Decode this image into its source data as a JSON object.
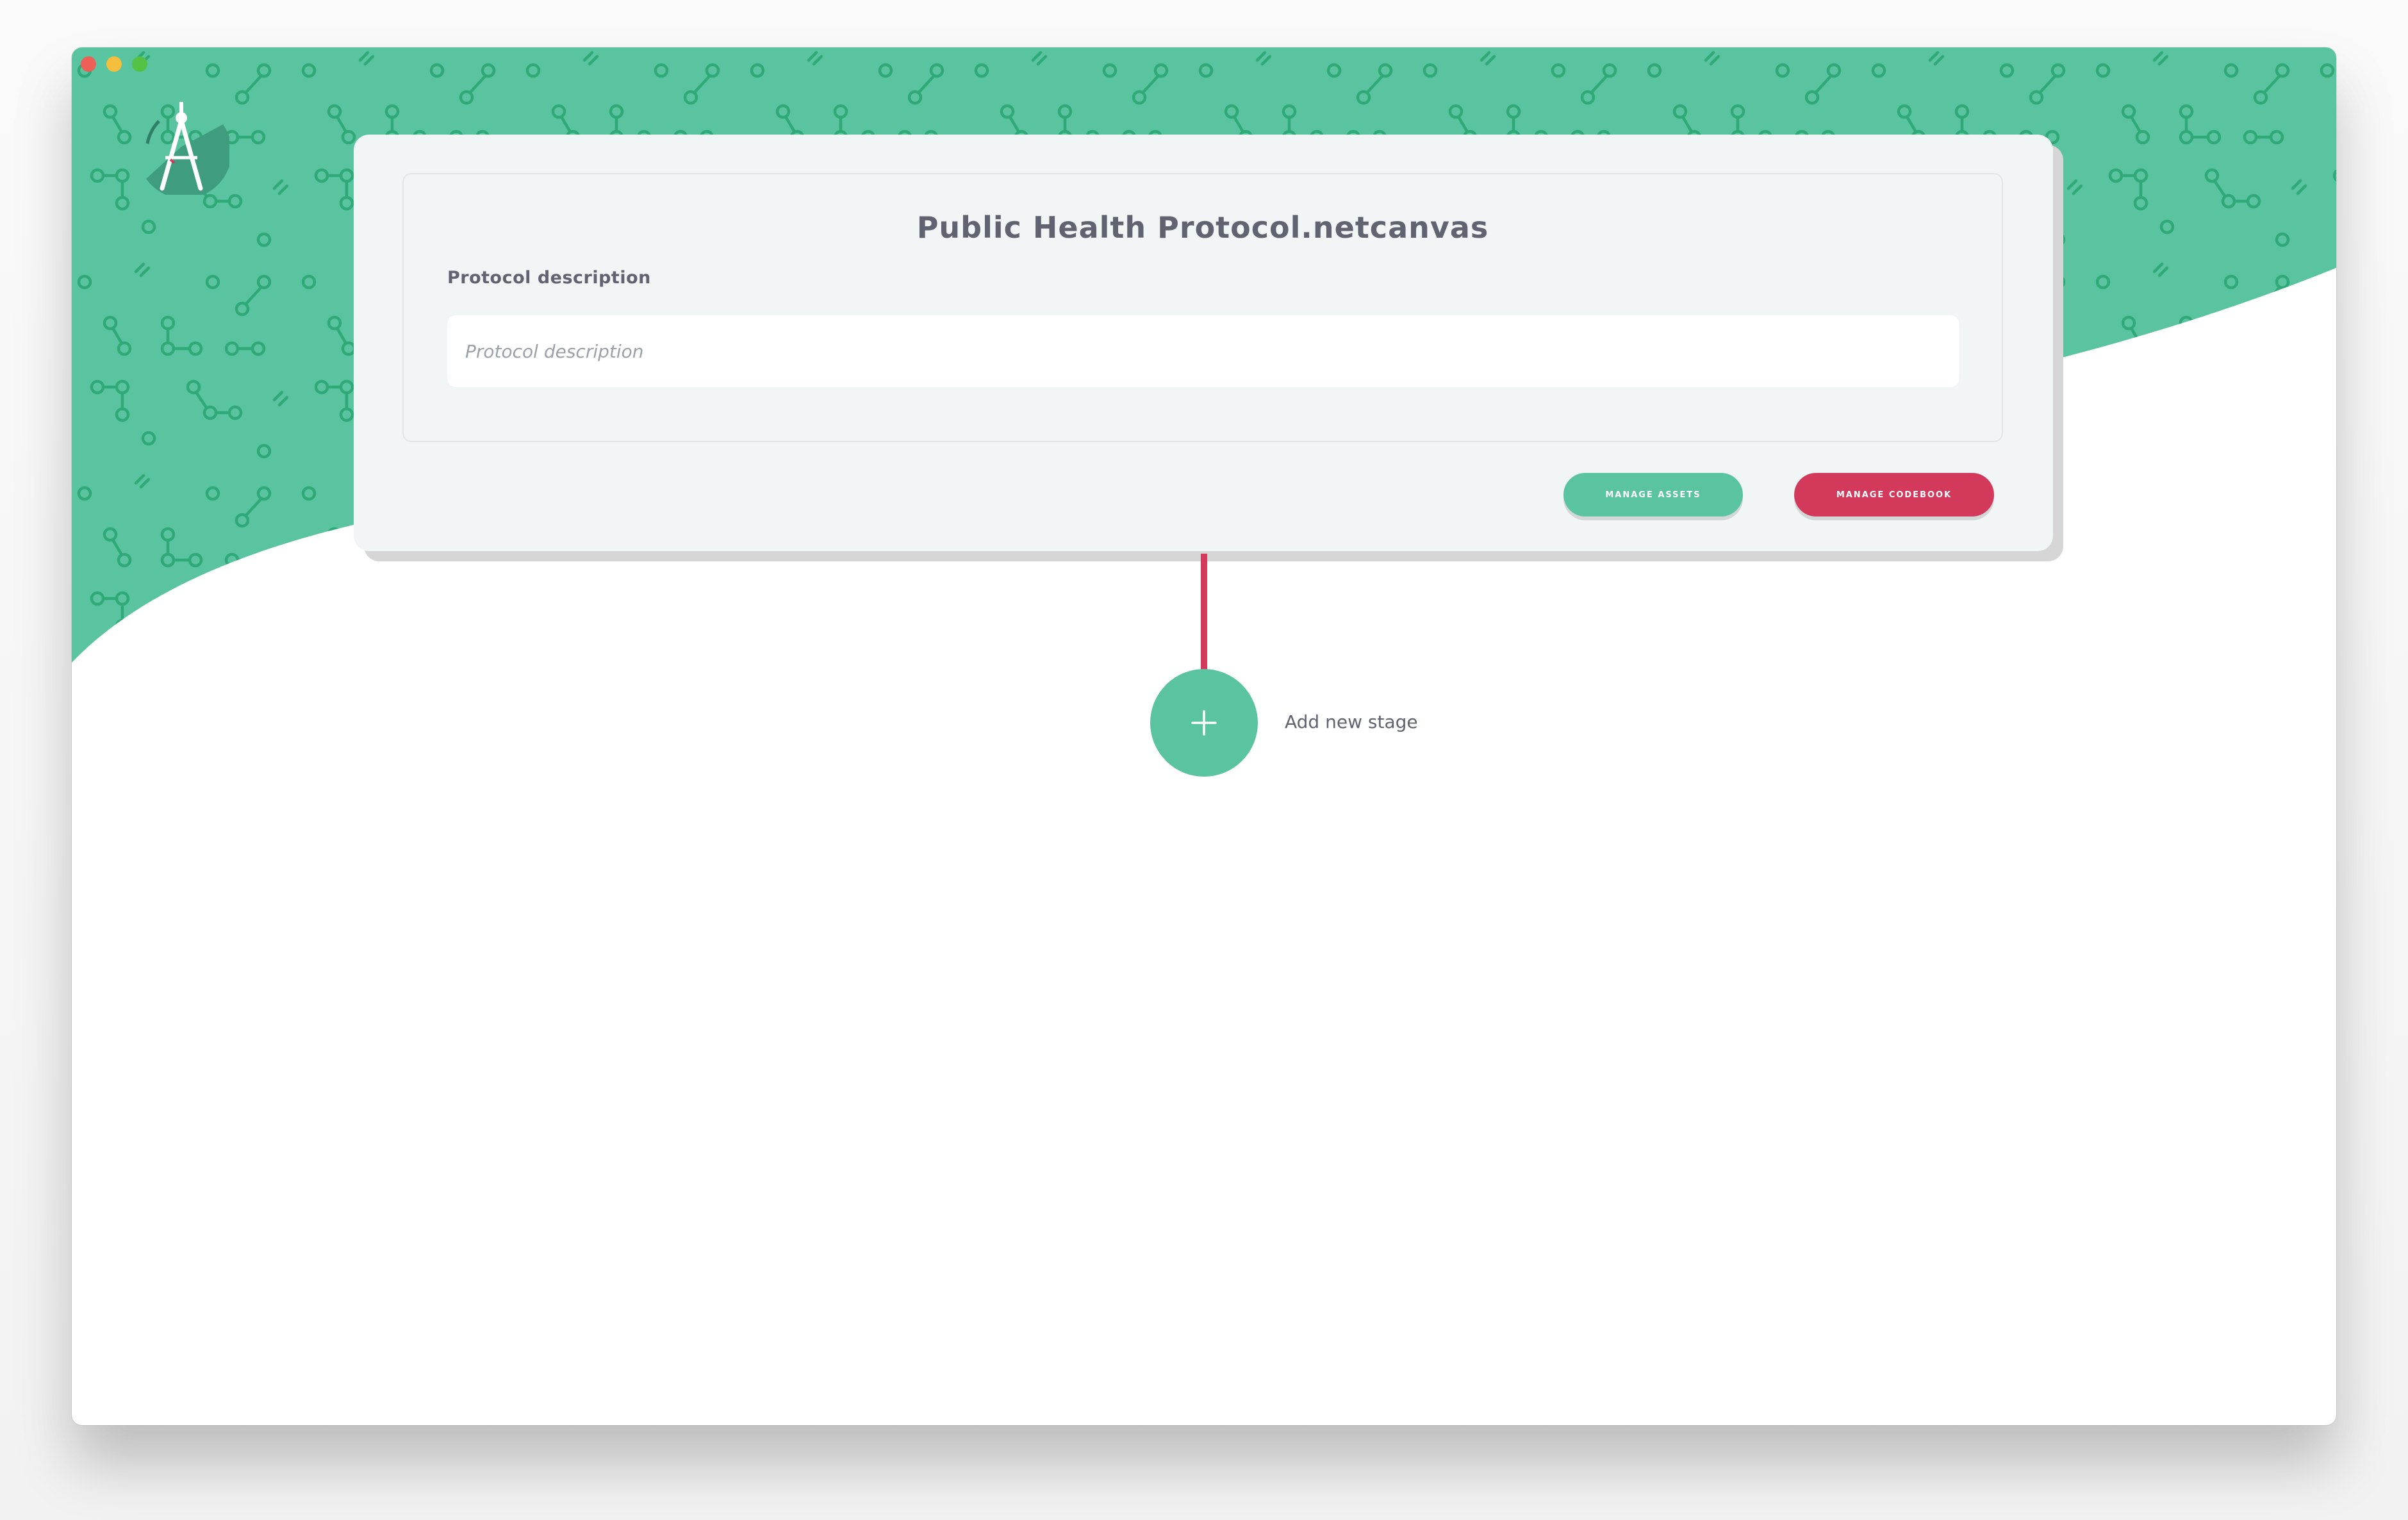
{
  "window": {
    "traffic_lights": [
      "close",
      "minimize",
      "maximize"
    ]
  },
  "logo": {
    "icon": "compass-icon"
  },
  "protocol": {
    "title": "Public Health Protocol.netcanvas",
    "description_label": "Protocol description",
    "description_value": "",
    "description_placeholder": "Protocol description"
  },
  "actions": {
    "manage_assets": "MANAGE ASSETS",
    "manage_codebook": "MANAGE CODEBOOK"
  },
  "timeline": {
    "add_stage_icon": "plus-icon",
    "add_stage_label": "Add new stage"
  },
  "colors": {
    "brand_green": "#5ac3a0",
    "brand_red": "#d3395a",
    "pattern_green": "#2fa978",
    "card_bg": "#f1f5f6",
    "text": "#5f6470"
  }
}
